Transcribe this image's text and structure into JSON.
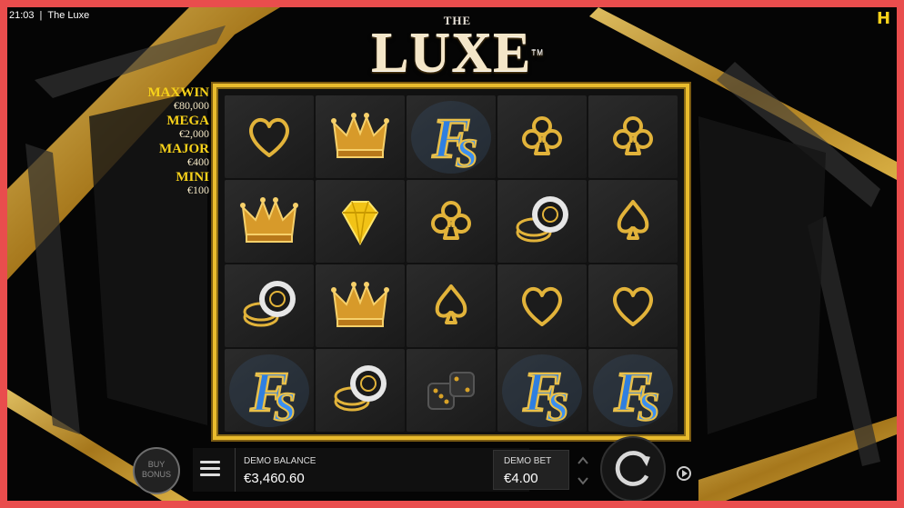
{
  "status_bar": {
    "time": "21:03",
    "separator": "|",
    "title": "The Luxe"
  },
  "brand_icon": "H",
  "logo": {
    "small": "THE",
    "big": "LUXE",
    "tm": "TM"
  },
  "jackpots": [
    {
      "name": "MAXWIN",
      "value": "€80,000"
    },
    {
      "name": "MEGA",
      "value": "€2,000"
    },
    {
      "name": "MAJOR",
      "value": "€400"
    },
    {
      "name": "MINI",
      "value": "€100"
    }
  ],
  "reels": [
    [
      "heart",
      "crown",
      "fs",
      "club",
      "club"
    ],
    [
      "crown",
      "diamond",
      "club",
      "chips",
      "spade"
    ],
    [
      "chips",
      "crown",
      "spade",
      "heart",
      "heart"
    ],
    [
      "fs",
      "chips",
      "dice",
      "fs",
      "fs"
    ]
  ],
  "controls": {
    "buy_bonus": "BUY BONUS",
    "balance_label": "DEMO BALANCE",
    "balance_value": "€3,460.60",
    "bet_label": "DEMO BET",
    "bet_value": "€4.00"
  },
  "colors": {
    "gold": "#e9bb2d",
    "jackpot": "#f7d21a",
    "fs_blue": "#2f7fe0"
  }
}
